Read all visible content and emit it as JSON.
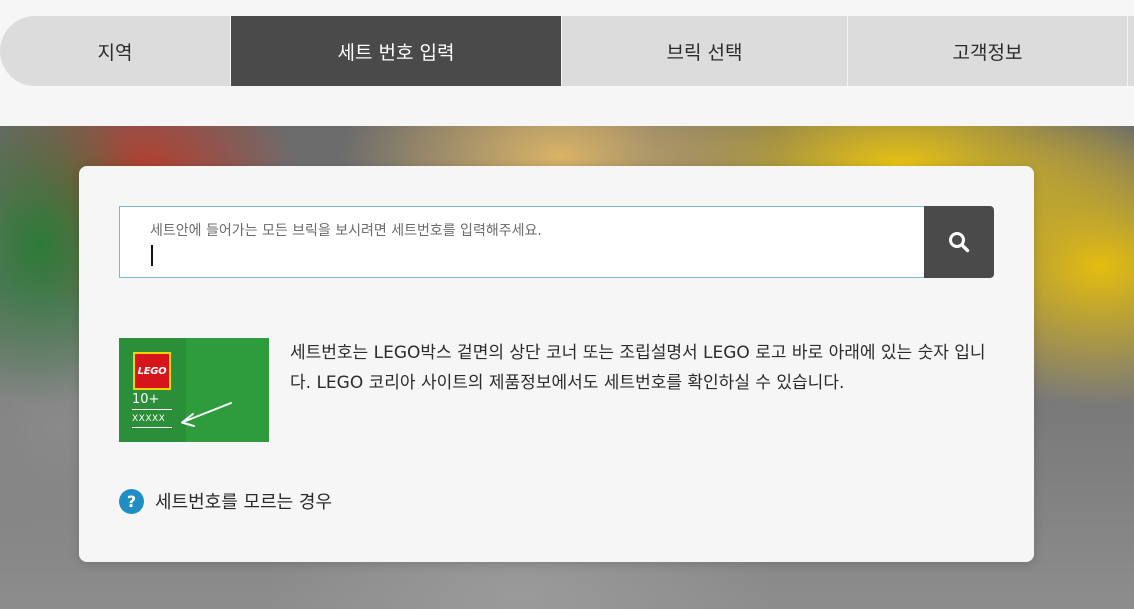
{
  "stepper": {
    "steps": [
      {
        "label": "지역"
      },
      {
        "label": "세트 번호 입력"
      },
      {
        "label": "브릭 선택"
      },
      {
        "label": "고객정보"
      }
    ]
  },
  "search": {
    "placeholder": "세트안에 들어가는 모든 브릭을 보시려면 세트번호를 입력해주세요.",
    "button_icon": "search-icon"
  },
  "info": {
    "image": {
      "logo_text": "LEGO",
      "age": "10+",
      "code": "XXXXX"
    },
    "text": "세트번호는 LEGO박스 겉면의 상단 코너 또는 조립설명서 LEGO 로고 바로 아래에 있는 숫자 입니다. LEGO 코리아 사이트의 제품정보에서도 세트번호를 확인하실 수 있습니다."
  },
  "help": {
    "icon": "question-circle-icon",
    "icon_glyph": "?",
    "label": "세트번호를 모르는 경우"
  },
  "colors": {
    "active_step": "#4a4a4a",
    "inactive_step": "#dcdcdc",
    "help_icon": "#1f8fc3",
    "lego_red": "#d6141c",
    "set_green": "#2e9c3d"
  }
}
